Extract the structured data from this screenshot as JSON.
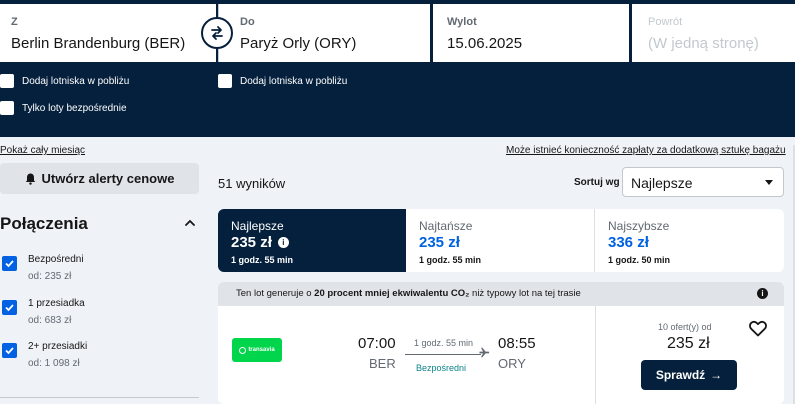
{
  "search": {
    "from_label": "Z",
    "from_value": "Berlin Brandenburg (BER)",
    "to_label": "Do",
    "to_value": "Paryż Orly (ORY)",
    "depart_label": "Wylot",
    "depart_value": "15.06.2025",
    "return_label": "Powrót",
    "return_value": "(W jedną stronę)"
  },
  "options": {
    "nearby_from": "Dodaj lotniska w pobliżu",
    "nearby_to": "Dodaj lotniska w pobliżu",
    "direct_only": "Tylko loty bezpośrednie"
  },
  "sidebar": {
    "show_month": "Pokaż cały miesiąc",
    "alert_button": "Utwórz alerty cenowe",
    "connections_title": "Połączenia",
    "stops": [
      {
        "label": "Bezpośredni",
        "price": "od: 235 zł",
        "checked": true
      },
      {
        "label": "1 przesiadka",
        "price": "od: 683 zł",
        "checked": true
      },
      {
        "label": "2+ przesiadki",
        "price": "od: 1 098 zł",
        "checked": true
      }
    ]
  },
  "results": {
    "baggage_note": "Może istnieć konieczność zapłaty za dodatkową sztukę bagażu",
    "count": "51 wyników",
    "sort_label": "Sortuj wg",
    "sort_value": "Najlepsze"
  },
  "tabs": [
    {
      "title": "Najlepsze",
      "price": "235 zł",
      "duration": "1 godz. 55 min"
    },
    {
      "title": "Najtańsze",
      "price": "235 zł",
      "duration": "1 godz. 55 min"
    },
    {
      "title": "Najszybsze",
      "price": "336 zł",
      "duration": "1 godz. 50 min"
    }
  ],
  "card": {
    "eco_prefix": "Ten lot generuje o ",
    "eco_bold": "20 procent mniej ekwiwalentu CO₂",
    "eco_suffix": " niż typowy lot na tej trasie",
    "airline": "transavia",
    "dep_time": "07:00",
    "dep_code": "BER",
    "arr_time": "08:55",
    "arr_code": "ORY",
    "duration": "1 godz. 55 min",
    "stops": "Bezpośredni",
    "offers": "10 ofert(y) od",
    "price": "235 zł",
    "button": "Sprawdź"
  },
  "colors": {
    "navy": "#05203c",
    "accent_blue": "#0062e3",
    "airline_green": "#00d54b",
    "direct_teal": "#0c838a"
  }
}
